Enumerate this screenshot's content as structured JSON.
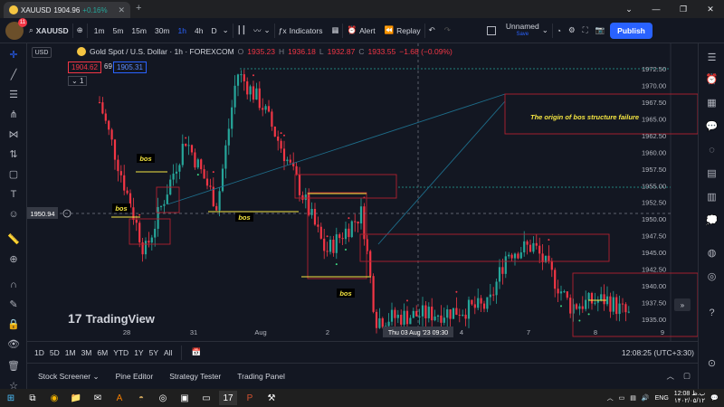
{
  "browser": {
    "tab_title": "XAUUSD",
    "tab_price": "1904.96",
    "tab_change": "+0.16%",
    "controls": [
      "⌄",
      "—",
      "❐",
      "✕"
    ]
  },
  "header": {
    "badge_count": "11",
    "symbol": "XAUUSD",
    "timeframes": [
      "1m",
      "5m",
      "15m",
      "30m",
      "1h",
      "4h",
      "D"
    ],
    "active_timeframe": "1h",
    "indicators_label": "Indicators",
    "alert_label": "Alert",
    "replay_label": "Replay",
    "layout_name": "Unnamed",
    "layout_status": "Save",
    "publish_label": "Publish"
  },
  "chart": {
    "currency_select": "USD",
    "legend_title": "Gold Spot / U.S. Dollar · 1h · FOREXCOM",
    "ohlc": {
      "O": "1935.23",
      "H": "1936.18",
      "L": "1932.87",
      "C": "1933.55",
      "change": "−1.68 (−0.09%)"
    },
    "sell_price": "1904.62",
    "spread": "69",
    "buy_price": "1905.31",
    "collapse_label": "1",
    "crosshair_price": "1950.94",
    "crosshair_time": "Thu 03 Aug '23   09:30",
    "annotation": "The origin of bos structure failure",
    "bos_label": "bos",
    "logo_text": "TradingView",
    "colors": {
      "up": "#26a69a",
      "down": "#f23645",
      "bos": "#f5e642",
      "zone": "#b2212f",
      "trend": "#1e6d8a"
    },
    "accent": "#2962ff"
  },
  "chart_data": {
    "type": "candlestick",
    "title": "Gold Spot / U.S. Dollar · 1h · FOREXCOM",
    "y_ticks": [
      "1972.50",
      "1970.00",
      "1967.50",
      "1965.00",
      "1962.50",
      "1960.00",
      "1957.50",
      "1955.00",
      "1952.50",
      "1950.00",
      "1947.50",
      "1945.00",
      "1942.50",
      "1940.00",
      "1937.50",
      "1935.00"
    ],
    "x_ticks": [
      "28",
      "31",
      "Aug",
      "2",
      "4",
      "7",
      "8",
      "9"
    ],
    "ylim": [
      1933.5,
      1975.0
    ],
    "grid": false
  },
  "date_bar": {
    "ranges": [
      "1D",
      "5D",
      "1M",
      "3M",
      "6M",
      "YTD",
      "1Y",
      "5Y",
      "All"
    ],
    "clock": "12:08:25 (UTC+3:30)"
  },
  "bottom_panel": {
    "tabs": [
      "Stock Screener",
      "Pine Editor",
      "Strategy Tester",
      "Trading Panel"
    ]
  },
  "taskbar": {
    "lang": "ENG",
    "time": "12:08 ب.ظ",
    "date": "۱۴۰۲/۰۵/۱۲"
  }
}
